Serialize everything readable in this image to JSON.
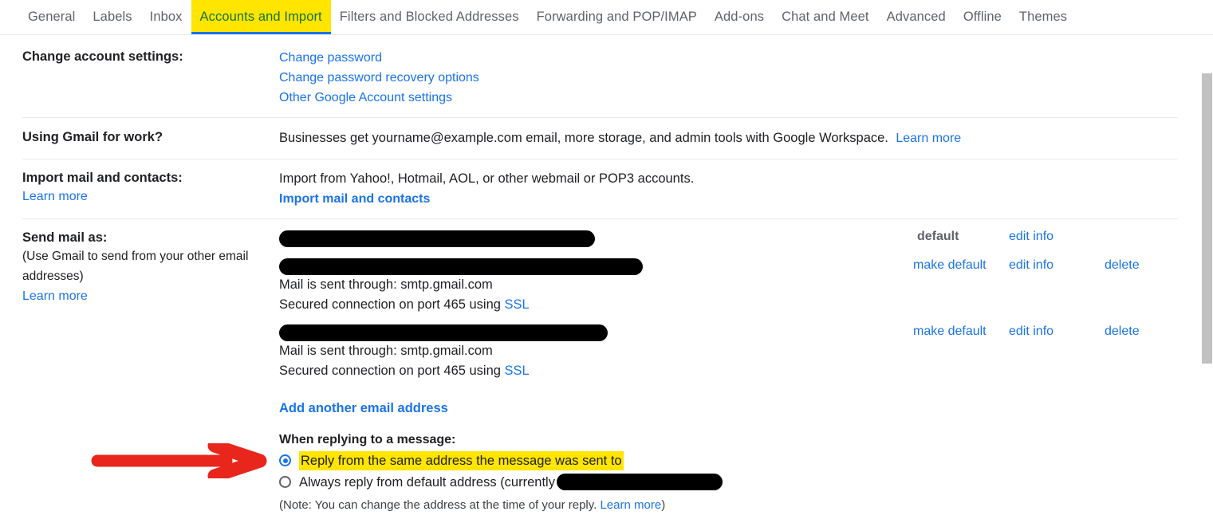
{
  "tabs": [
    {
      "label": "General",
      "highlighted": false
    },
    {
      "label": "Labels",
      "highlighted": false
    },
    {
      "label": "Inbox",
      "highlighted": false
    },
    {
      "label": "Accounts and Import",
      "highlighted": true
    },
    {
      "label": "Filters and Blocked Addresses",
      "highlighted": false
    },
    {
      "label": "Forwarding and POP/IMAP",
      "highlighted": false
    },
    {
      "label": "Add-ons",
      "highlighted": false
    },
    {
      "label": "Chat and Meet",
      "highlighted": false
    },
    {
      "label": "Advanced",
      "highlighted": false
    },
    {
      "label": "Offline",
      "highlighted": false
    },
    {
      "label": "Themes",
      "highlighted": false
    }
  ],
  "change_account_settings": {
    "label": "Change account settings:",
    "links": [
      "Change password",
      "Change password recovery options",
      "Other Google Account settings"
    ]
  },
  "using_gmail_for_work": {
    "label": "Using Gmail for work?",
    "text": "Businesses get yourname@example.com email, more storage, and admin tools with Google Workspace.",
    "link": "Learn more"
  },
  "import_mail_and_contacts": {
    "label": "Import mail and contacts:",
    "label_link": "Learn more",
    "text": "Import from Yahoo!, Hotmail, AOL, or other webmail or POP3 accounts.",
    "action_link": "Import mail and contacts"
  },
  "send_mail_as": {
    "label": "Send mail as:",
    "sub": "(Use Gmail to send from your other email addresses)",
    "label_link": "Learn more",
    "add_another_link": "Add another email address",
    "entries": [
      {
        "address_redacted": true,
        "redact_width": 396,
        "details": [],
        "actions": [
          {
            "label": "default",
            "type": "static"
          },
          {
            "label": "edit info",
            "type": "link"
          }
        ]
      },
      {
        "address_redacted": true,
        "redact_width": 456,
        "details": [
          {
            "text": "Mail is sent through: smtp.gmail.com",
            "link": ""
          },
          {
            "text": "Secured connection on port 465 using ",
            "link": "SSL"
          }
        ],
        "actions": [
          {
            "label": "make default",
            "type": "link"
          },
          {
            "label": "edit info",
            "type": "link"
          },
          {
            "label": "delete",
            "type": "link"
          }
        ]
      },
      {
        "address_redacted": true,
        "redact_width": 412,
        "details": [
          {
            "text": "Mail is sent through: smtp.gmail.com",
            "link": ""
          },
          {
            "text": "Secured connection on port 465 using ",
            "link": "SSL"
          }
        ],
        "actions": [
          {
            "label": "make default",
            "type": "link"
          },
          {
            "label": "edit info",
            "type": "link"
          },
          {
            "label": "delete",
            "type": "link"
          }
        ]
      }
    ],
    "reply_section": {
      "title": "When replying to a message:",
      "options": [
        {
          "label": "Reply from the same address the message was sent to",
          "checked": true,
          "highlighted": true,
          "redacted_suffix": false
        },
        {
          "label": "Always reply from default address (currently",
          "checked": false,
          "highlighted": false,
          "redacted_suffix": true,
          "redact_width": 208
        }
      ],
      "note_text": "(Note: You can change the address at the time of your reply. ",
      "note_link": "Learn more",
      "note_close": ")"
    }
  },
  "annotations": {
    "arrow": {
      "name": "red-arrow-pointer",
      "color": "#e8261c"
    },
    "highlight_color": "#ffe500",
    "tab_highlight_text_color": "#137333",
    "link_color": "#1a73e8"
  },
  "scrollbar": {
    "thumb_color": "#c1c1c1"
  }
}
